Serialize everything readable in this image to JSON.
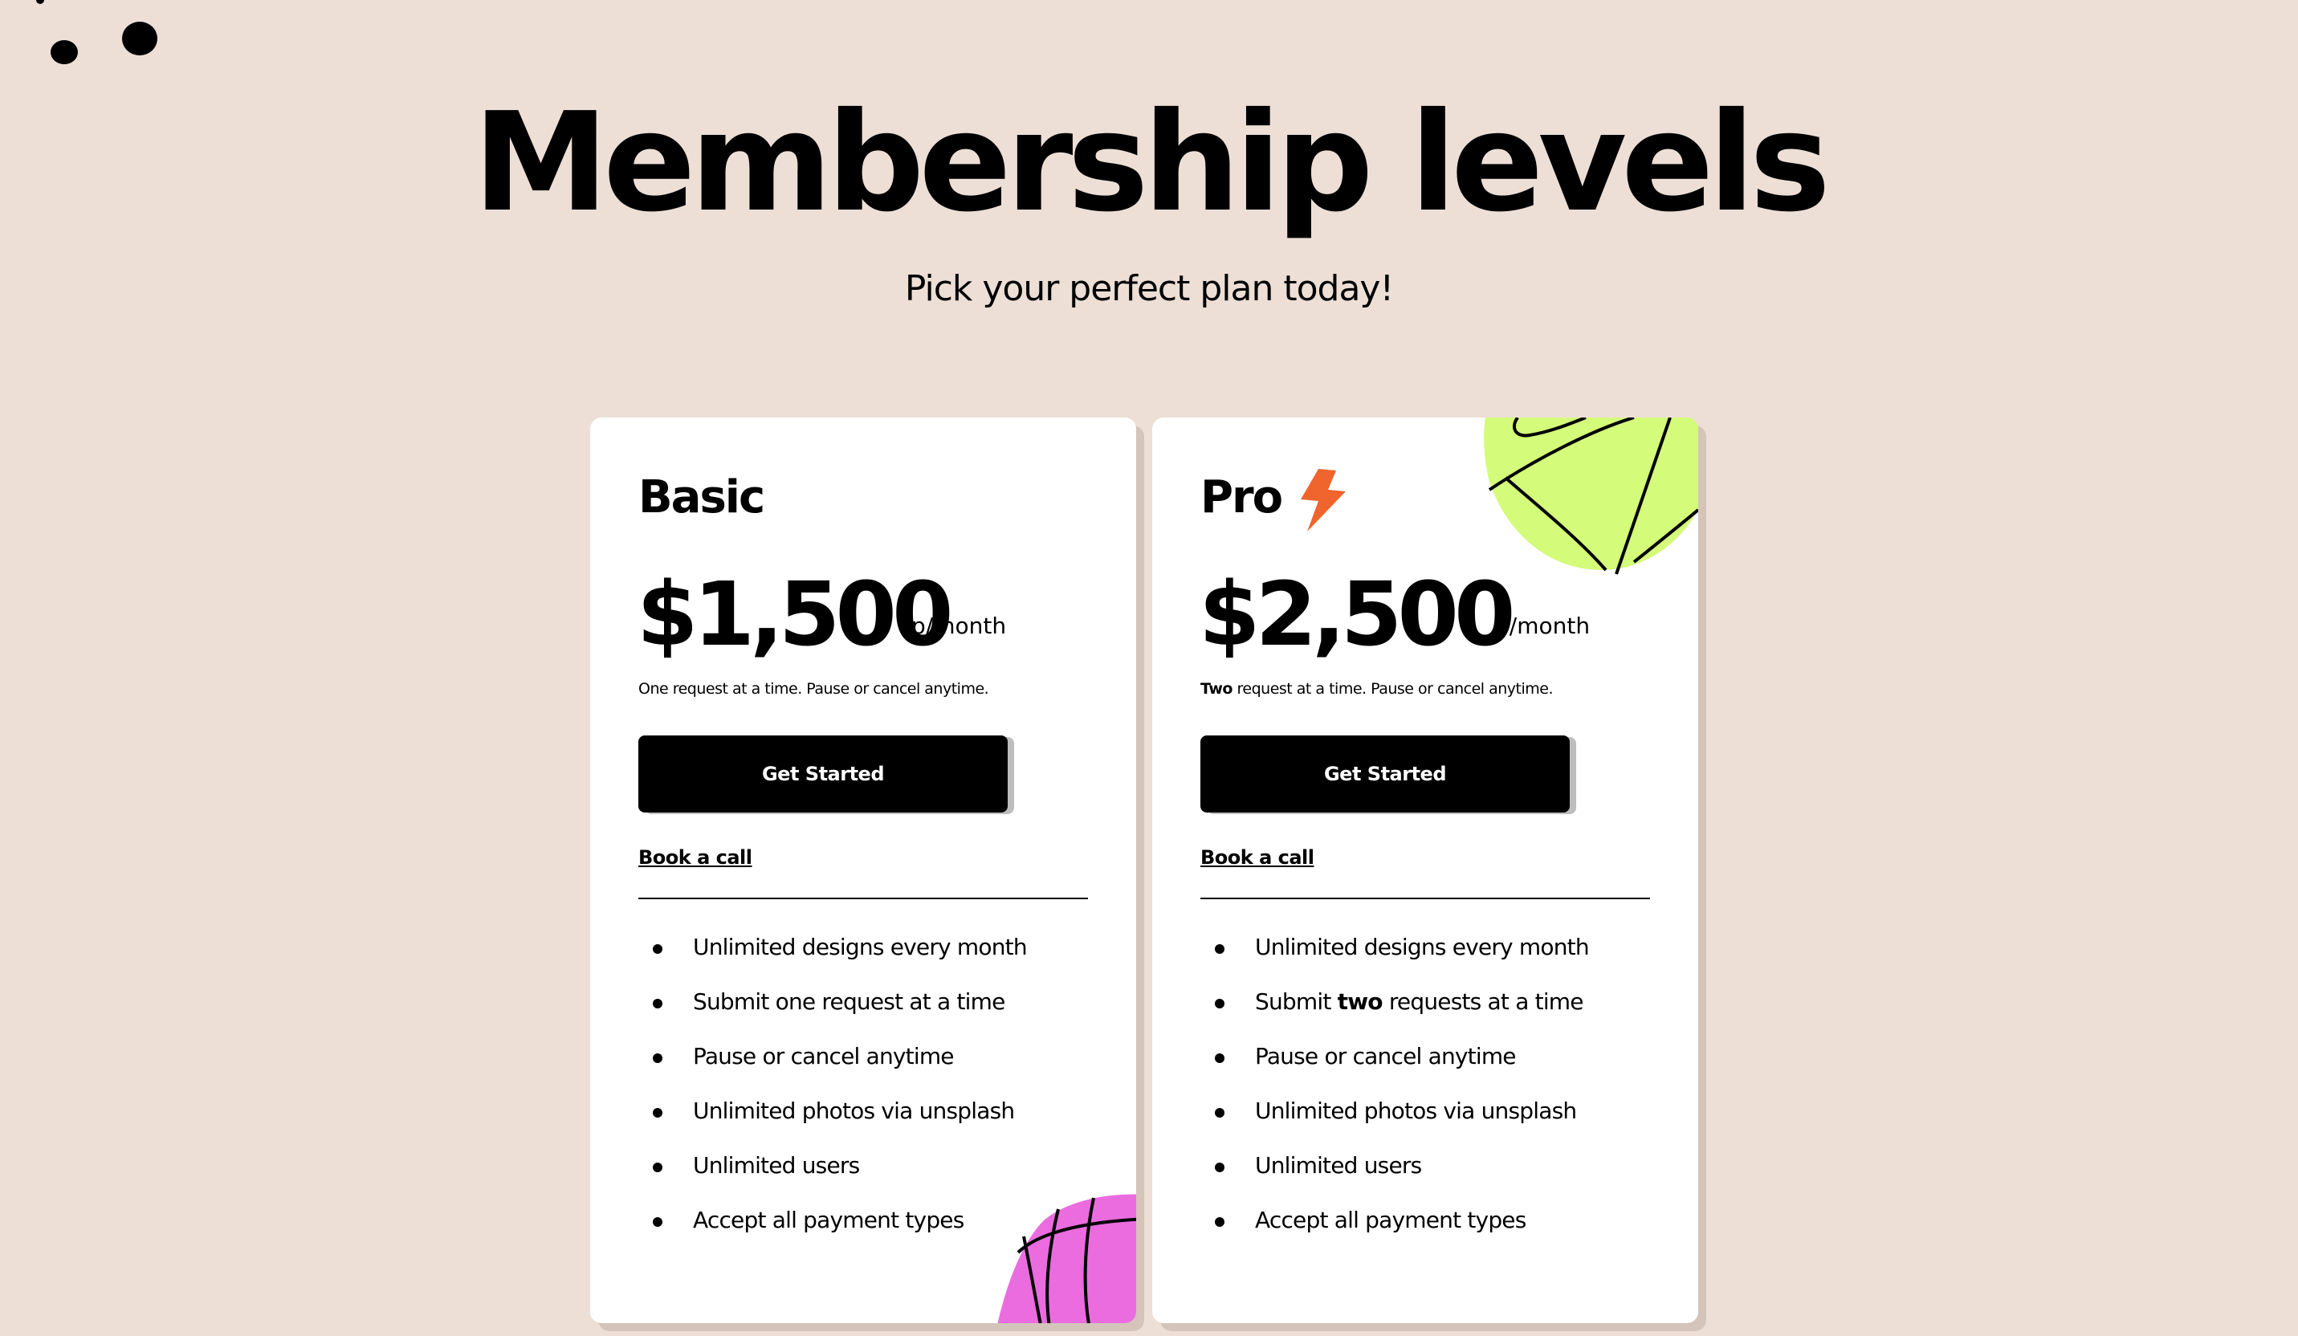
{
  "colors": {
    "background": "#eddfd6",
    "card": "#ffffff",
    "card_shadow": "#d4c4b9",
    "button": "#000000",
    "button_text": "#ffffff",
    "button_shadow": "#bdbdbd",
    "accent_bolt": "#f0642d",
    "blob_lime": "#d4fb79",
    "blob_pink": "#ea6cdf"
  },
  "hero": {
    "title": "Membership levels",
    "subtitle": "Pick your perfect plan today!"
  },
  "plans": [
    {
      "name": "Basic",
      "price": "$1,500",
      "period": "p/month",
      "description_bold": "",
      "description": "One request at a time. Pause or cancel anytime.",
      "cta_label": "Get Started",
      "link_label": "Book a call",
      "features": [
        {
          "bold": "",
          "pre": "Unlimited designs every month",
          "post": ""
        },
        {
          "bold": "",
          "pre": "Submit one request at a time",
          "post": ""
        },
        {
          "bold": "",
          "pre": "Pause or cancel anytime",
          "post": ""
        },
        {
          "bold": "",
          "pre": "Unlimited photos via unsplash",
          "post": ""
        },
        {
          "bold": "",
          "pre": "Unlimited users",
          "post": ""
        },
        {
          "bold": "",
          "pre": "Accept all payment types",
          "post": ""
        }
      ],
      "decoration": "pink-ball-icon"
    },
    {
      "name": "Pro",
      "badge_icon": "lightning-bolt-icon",
      "price": "$2,500",
      "period": "p/month",
      "description_bold": "Two",
      "description": " request at a time. Pause or cancel anytime.",
      "cta_label": "Get Started",
      "link_label": "Book a call",
      "features": [
        {
          "pre": "Unlimited designs every month",
          "bold": "",
          "post": ""
        },
        {
          "pre": "Submit ",
          "bold": "two",
          "post": " requests at a time"
        },
        {
          "pre": "Pause or cancel anytime",
          "bold": "",
          "post": ""
        },
        {
          "pre": "Unlimited photos via unsplash",
          "bold": "",
          "post": ""
        },
        {
          "pre": "Unlimited users",
          "bold": "",
          "post": ""
        },
        {
          "pre": "Accept all payment types",
          "bold": "",
          "post": ""
        }
      ],
      "decoration": "lime-ball-icon"
    }
  ]
}
